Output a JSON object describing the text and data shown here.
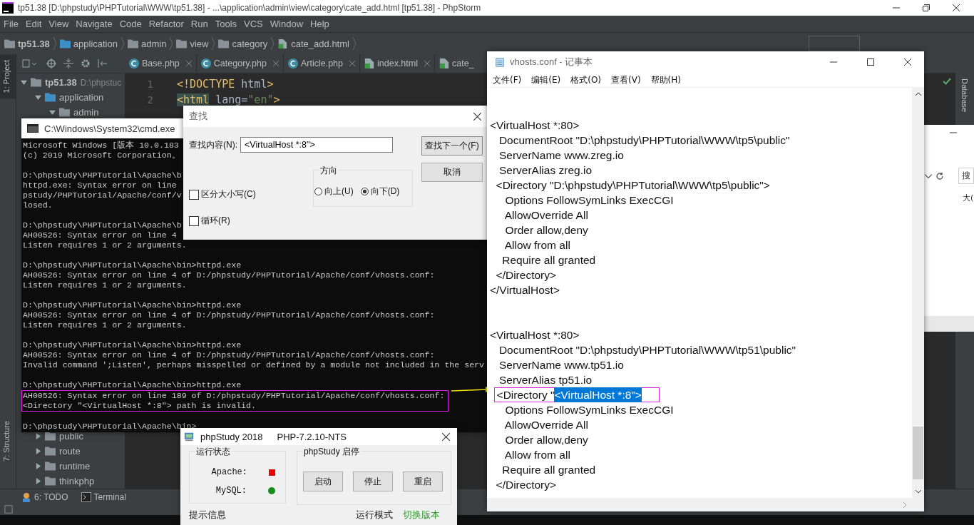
{
  "ide": {
    "title": "tp51.38 [D:\\phpstudy\\PHPTutorial\\WWW\\tp51.38] - ...\\application\\admin\\view\\category\\cate_add.html [tp51.38] - PhpStorm",
    "menu": [
      "File",
      "Edit",
      "View",
      "Navigate",
      "Code",
      "Refactor",
      "Run",
      "Tools",
      "VCS",
      "Window",
      "Help"
    ],
    "breadcrumb": [
      {
        "label": "tp51.38",
        "kind": "project"
      },
      {
        "label": "application",
        "kind": "source"
      },
      {
        "label": "admin",
        "kind": "folder"
      },
      {
        "label": "view",
        "kind": "folder"
      },
      {
        "label": "category",
        "kind": "folder"
      },
      {
        "label": "cate_add.html",
        "kind": "html"
      }
    ],
    "left_tabs": [
      {
        "label": "1: Project",
        "selected": true
      },
      {
        "label": "7: Structure",
        "selected": false
      }
    ],
    "right_tabs": [
      "Database"
    ],
    "project_tree": [
      {
        "label": "tp51.38",
        "path": "D:\\phpstuc",
        "kind": "folder",
        "expanded": true,
        "children": [
          {
            "label": "application",
            "kind": "source",
            "expanded": true,
            "children": [
              {
                "label": "admin",
                "kind": "folder",
                "expanded": true
              }
            ]
          },
          {
            "label": "public",
            "kind": "folder",
            "expanded": false
          },
          {
            "label": "route",
            "kind": "folder",
            "expanded": false
          },
          {
            "label": "runtime",
            "kind": "folder",
            "expanded": false
          },
          {
            "label": "thinkphp",
            "kind": "folder",
            "expanded": false
          }
        ]
      }
    ],
    "editor_tabs": [
      {
        "label": "Base.php",
        "kind": "class"
      },
      {
        "label": "Category.php",
        "kind": "class"
      },
      {
        "label": "Article.php",
        "kind": "class"
      },
      {
        "label": "index.html",
        "kind": "html"
      },
      {
        "label": "cate_",
        "kind": "html"
      }
    ],
    "code": [
      {
        "number": "1",
        "tokens": [
          {
            "text": "<!DOCTYPE",
            "kind": "tag"
          },
          {
            "text": " html",
            "kind": "plain"
          },
          {
            "text": ">",
            "kind": "tag"
          }
        ]
      },
      {
        "number": "2",
        "tokens": [
          {
            "text": "<html",
            "kind": "matched"
          },
          {
            "text": " lang=",
            "kind": "plain"
          },
          {
            "text": "\"en\"",
            "kind": "string"
          },
          {
            "text": ">",
            "kind": "tag"
          }
        ]
      }
    ],
    "bottom_tabs": [
      {
        "label": "6: TODO",
        "kind": "todo"
      },
      {
        "label": "Terminal",
        "kind": "terminal"
      }
    ]
  },
  "browser": {
    "button": "搜",
    "text": "大("
  },
  "cmd": {
    "title": "C:\\Windows\\System32\\cmd.exe",
    "blocks": [
      [
        {
          "text": "Microsoft Windows [版本 10.0.183"
        },
        {
          "text": "(c) 2019 Microsoft Corporation。"
        }
      ],
      [
        {
          "text": "D:\\phpstudy\\PHPTutorial\\Apache\\b"
        },
        {
          "text": "httpd.exe: Syntax error on line"
        },
        {
          "text": "pstudy/PHPTutorial/Apache/conf/v"
        },
        {
          "text": "losed."
        }
      ],
      [
        {
          "text": "D:\\phpstudy\\PHPTutorial\\Apache\\b"
        },
        {
          "text": "AH00526: Syntax error on line 4"
        },
        {
          "text": "Listen requires 1 or 2 arguments."
        }
      ],
      [
        {
          "text": "D:\\phpstudy\\PHPTutorial\\Apache\\bin>httpd.exe"
        },
        {
          "text": "AH00526: Syntax error on line 4 of D:/phpstudy/PHPTutorial/Apache/conf/vhosts.conf:"
        },
        {
          "text": "Listen requires 1 or 2 arguments."
        }
      ],
      [
        {
          "text": "D:\\phpstudy\\PHPTutorial\\Apache\\bin>httpd.exe"
        },
        {
          "text": "AH00526: Syntax error on line 4 of D:/phpstudy/PHPTutorial/Apache/conf/vhosts.conf:"
        },
        {
          "text": "Listen requires 1 or 2 arguments."
        }
      ],
      [
        {
          "text": "D:\\phpstudy\\PHPTutorial\\Apache\\bin>httpd.exe"
        },
        {
          "text": "AH00526: Syntax error on line 4 of D:/phpstudy/PHPTutorial/Apache/conf/vhosts.conf:"
        },
        {
          "text": "Invalid command ';Listen', perhaps misspelled or defined by a module not included in the serv"
        }
      ],
      [
        {
          "text": "D:\\phpstudy\\PHPTutorial\\Apache\\bin>httpd.exe"
        },
        {
          "text": "AH00526: Syntax error on line 189 of D:/phpstudy/PHPTutorial/Apache/conf/vhosts.conf:",
          "highlighted": true
        },
        {
          "text": "<Directory \"<VirtualHost *:8\"> path is invalid.",
          "highlighted": true
        }
      ],
      [
        {
          "text": "D:\\phpstudy\\PHPTutorial\\Apache\\bin>"
        }
      ]
    ]
  },
  "find_dialog": {
    "title": "查找",
    "label": "查找内容(N):",
    "value": "<VirtualHost *:8\">",
    "buttons": [
      "查找下一个(F)",
      "取消"
    ],
    "direction": {
      "label": "方向",
      "options": [
        {
          "label": "向上(U)",
          "selected": false
        },
        {
          "label": "向下(D)",
          "selected": true
        }
      ]
    },
    "options": [
      {
        "label": "区分大小写(C)",
        "checked": false
      },
      {
        "label": "循环(R)",
        "checked": false
      }
    ]
  },
  "notepad": {
    "title": "vhosts.conf - 记事本",
    "menu": [
      "文件(F)",
      "编辑(E)",
      "格式(O)",
      "查看(V)",
      "帮助(H)"
    ],
    "blocks": [
      [
        {
          "text": "<VirtualHost *:80>"
        },
        {
          "text": "   DocumentRoot \"D:\\phpstudy\\PHPTutorial\\WWW\\tp5\\public\""
        },
        {
          "text": "   ServerName www.zreg.io"
        },
        {
          "text": "   ServerAlias zreg.io"
        },
        {
          "text": "  <Directory \"D:\\phpstudy\\PHPTutorial\\WWW\\tp5\\public\">"
        },
        {
          "text": "     Options FollowSymLinks ExecCGI"
        },
        {
          "text": "     AllowOverride All"
        },
        {
          "text": "     Order allow,deny"
        },
        {
          "text": "     Allow from all"
        },
        {
          "text": "    Require all granted"
        },
        {
          "text": "  </Directory>"
        },
        {
          "text": "</VirtualHost>"
        }
      ],
      [
        {
          "text": "<VirtualHost *:80>"
        },
        {
          "text": "   DocumentRoot \"D:\\phpstudy\\PHPTutorial\\WWW\\tp51\\public\""
        },
        {
          "text": "   ServerName www.tp51.io"
        },
        {
          "text": "   ServerAlias tp51.io"
        },
        {
          "text": "  <Directory \"",
          "selection": "<VirtualHost *:8\">",
          "boxed": true
        },
        {
          "text": "     Options FollowSymLinks ExecCGI"
        },
        {
          "text": "     AllowOverride All"
        },
        {
          "text": "     Order allow,deny"
        },
        {
          "text": "     Allow from all"
        },
        {
          "text": "    Require all granted"
        },
        {
          "text": "  </Directory>"
        }
      ]
    ]
  },
  "phpstudy": {
    "title": "phpStudy 2018",
    "version": "PHP-7.2.10-NTS",
    "status_label": "运行状态",
    "services": [
      {
        "name": "Apache:",
        "running": false
      },
      {
        "name": "MySQL:",
        "running": true
      }
    ],
    "control_label": "phpStudy 启停",
    "buttons": [
      "启动",
      "停止",
      "重启"
    ],
    "info_label": "提示信息",
    "mode_label": "运行模式",
    "switch_link": "切换版本"
  }
}
